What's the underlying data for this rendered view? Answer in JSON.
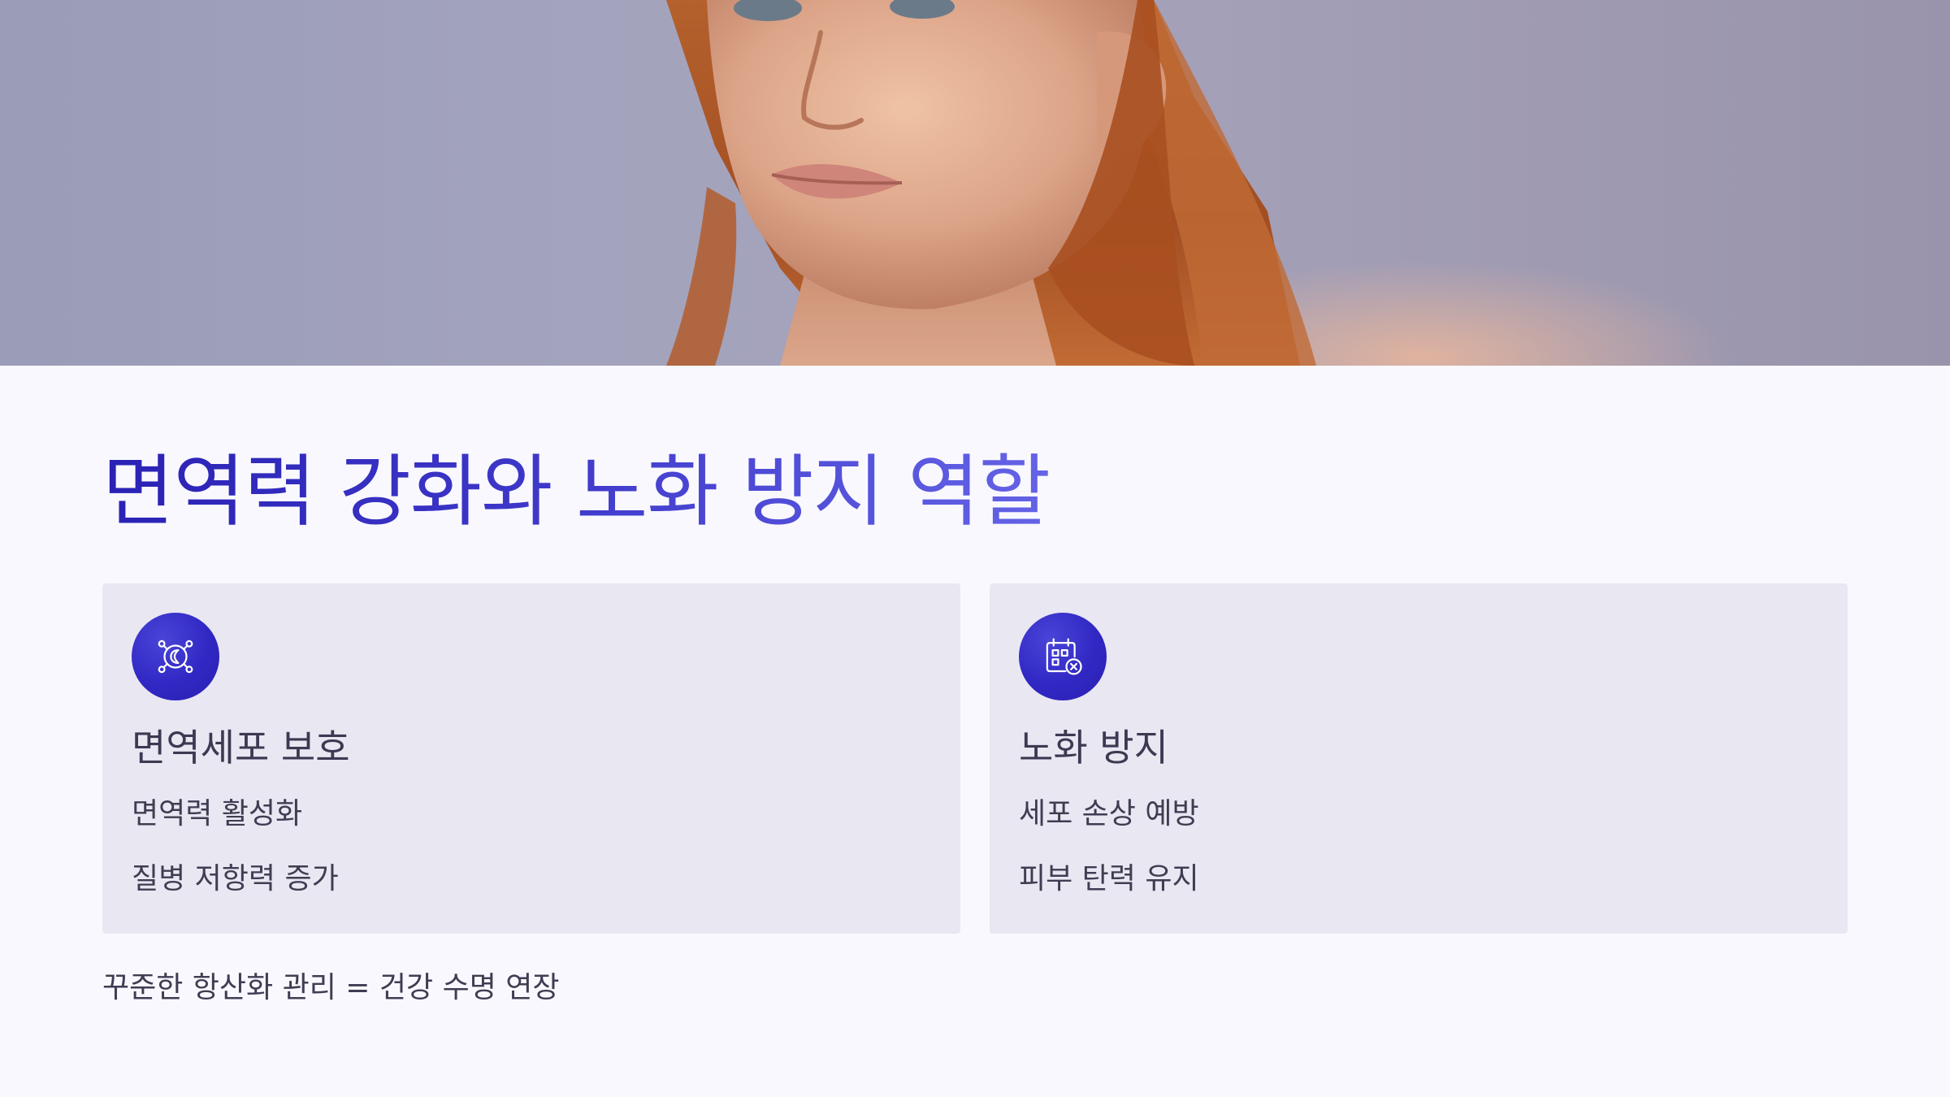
{
  "hero": {
    "image": "portrait-photo",
    "colors": {
      "background": "#9f9fb8",
      "skin": "#e0a98e",
      "hair": "#b05a2a"
    }
  },
  "title": "면역력 강화와 노화 방지 역할",
  "cards": [
    {
      "icon": "immune-cell-icon",
      "title": "면역세포 보호",
      "items": [
        "면역력 활성화",
        "질병 저항력 증가"
      ]
    },
    {
      "icon": "calendar-cancel-icon",
      "title": "노화 방지",
      "items": [
        "세포 손상 예방",
        "피부 탄력 유지"
      ]
    }
  ],
  "footer_note": "꾸준한 항산화 관리 = 건강 수명 연장",
  "colors": {
    "accent": "#3128c4",
    "title_gradient_start": "#2a22b4",
    "title_gradient_end": "#6463e6",
    "card_background": "#e9e7f2",
    "page_background": "#f9f8fe",
    "text": "#3f3d52"
  }
}
